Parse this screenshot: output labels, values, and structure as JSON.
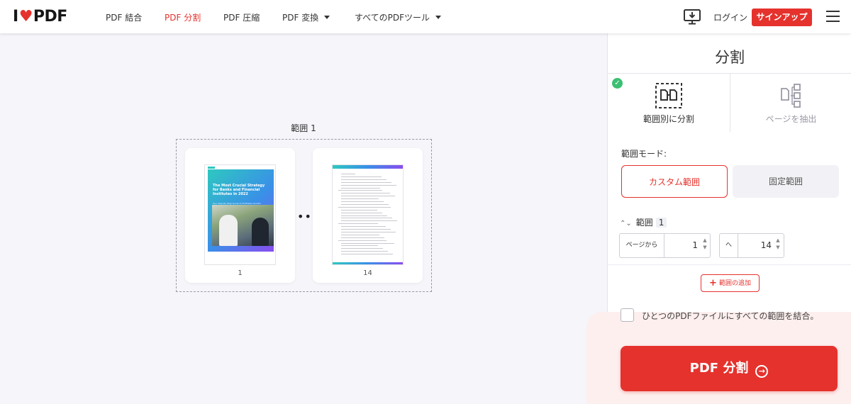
{
  "header": {
    "logo_left": "I",
    "logo_right": "PDF",
    "nav": [
      {
        "label": "PDF 結合",
        "active": false
      },
      {
        "label": "PDF 分割",
        "active": true
      },
      {
        "label": "PDF 圧縮",
        "active": false
      },
      {
        "label": "PDF 変換",
        "active": false
      },
      {
        "label": "すべてのPDFツール",
        "active": false
      }
    ],
    "login": "ログイン",
    "signup": "サインアップ"
  },
  "workspace": {
    "range_label": "範囲 1",
    "pages": [
      {
        "number": "1",
        "cover_title": "The Most Crucial Strategy for Banks and Financial Institutes in 2022",
        "cover_subtitle": "Your Step-By-Step Guide to Profitable Growth"
      },
      {
        "number": "14"
      }
    ],
    "ellipsis": "•••"
  },
  "panel": {
    "title": "分割",
    "tabs": [
      {
        "label": "範囲別に分割",
        "selected": true
      },
      {
        "label": "ページを抽出",
        "selected": false
      }
    ],
    "mode_label": "範囲モード:",
    "mode_custom": "カスタム範囲",
    "mode_fixed": "固定範囲",
    "range_title": "範囲",
    "range_number": "1",
    "from_prefix": "ページから",
    "from_value": "1",
    "to_prefix": "へ",
    "to_value": "14",
    "add_range": "範囲の追加",
    "merge_label": "ひとつのPDFファイルにすべての範囲を結合。",
    "submit": "PDF 分割"
  },
  "colors": {
    "accent": "#e5322d",
    "success": "#3cbf72",
    "background": "#f5f5fa"
  }
}
